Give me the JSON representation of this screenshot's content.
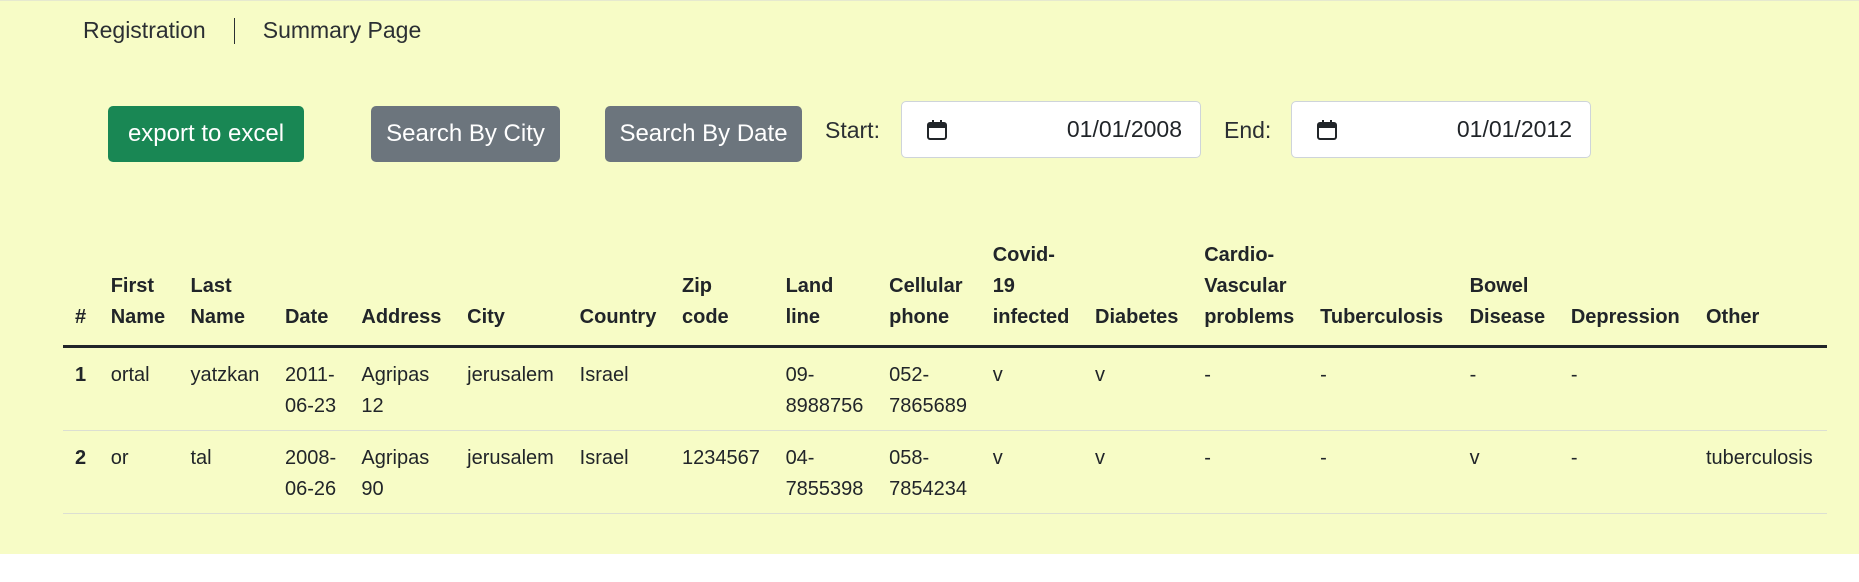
{
  "nav": {
    "registration": "Registration",
    "summary": "Summary Page"
  },
  "toolbar": {
    "export_label": "export to excel",
    "city_label": "Search By City",
    "date_label": "Search By Date",
    "start_label": "Start:",
    "start_value": "01/01/2008",
    "end_label": "End:",
    "end_value": "01/01/2012"
  },
  "colors": {
    "background": "#f7fcc6",
    "export_button": "#198754",
    "search_button": "#6c757d"
  },
  "icons": {
    "start": "calendar-icon",
    "end": "calendar-icon"
  },
  "table": {
    "headers": [
      [
        "#"
      ],
      [
        "First",
        "Name"
      ],
      [
        "Last",
        "Name"
      ],
      [
        "Date"
      ],
      [
        "Address"
      ],
      [
        "City"
      ],
      [
        "Country"
      ],
      [
        "Zip",
        "code"
      ],
      [
        "Land",
        "line"
      ],
      [
        "Cellular",
        "phone"
      ],
      [
        "Covid-",
        "19",
        "infected"
      ],
      [
        "Diabetes"
      ],
      [
        "Cardio-",
        "Vascular",
        "problems"
      ],
      [
        "Tuberculosis"
      ],
      [
        "Bowel",
        "Disease"
      ],
      [
        "Depression"
      ],
      [
        "Other"
      ]
    ],
    "rows": [
      [
        [
          "1"
        ],
        [
          "ortal"
        ],
        [
          "yatzkan"
        ],
        [
          "2011-",
          "06-23"
        ],
        [
          "Agripas",
          "12"
        ],
        [
          "jerusalem"
        ],
        [
          "Israel"
        ],
        [
          ""
        ],
        [
          "09-",
          "8988756"
        ],
        [
          "052-",
          "7865689"
        ],
        [
          "v"
        ],
        [
          "v"
        ],
        [
          "-"
        ],
        [
          "-"
        ],
        [
          "-"
        ],
        [
          "-"
        ],
        [
          ""
        ]
      ],
      [
        [
          "2"
        ],
        [
          "or"
        ],
        [
          "tal"
        ],
        [
          "2008-",
          "06-26"
        ],
        [
          "Agripas",
          "90"
        ],
        [
          "jerusalem"
        ],
        [
          "Israel"
        ],
        [
          "1234567"
        ],
        [
          "04-",
          "7855398"
        ],
        [
          "058-",
          "7854234"
        ],
        [
          "v"
        ],
        [
          "v"
        ],
        [
          "-"
        ],
        [
          "-"
        ],
        [
          "v"
        ],
        [
          "-"
        ],
        [
          "tuberculosis"
        ]
      ]
    ]
  }
}
